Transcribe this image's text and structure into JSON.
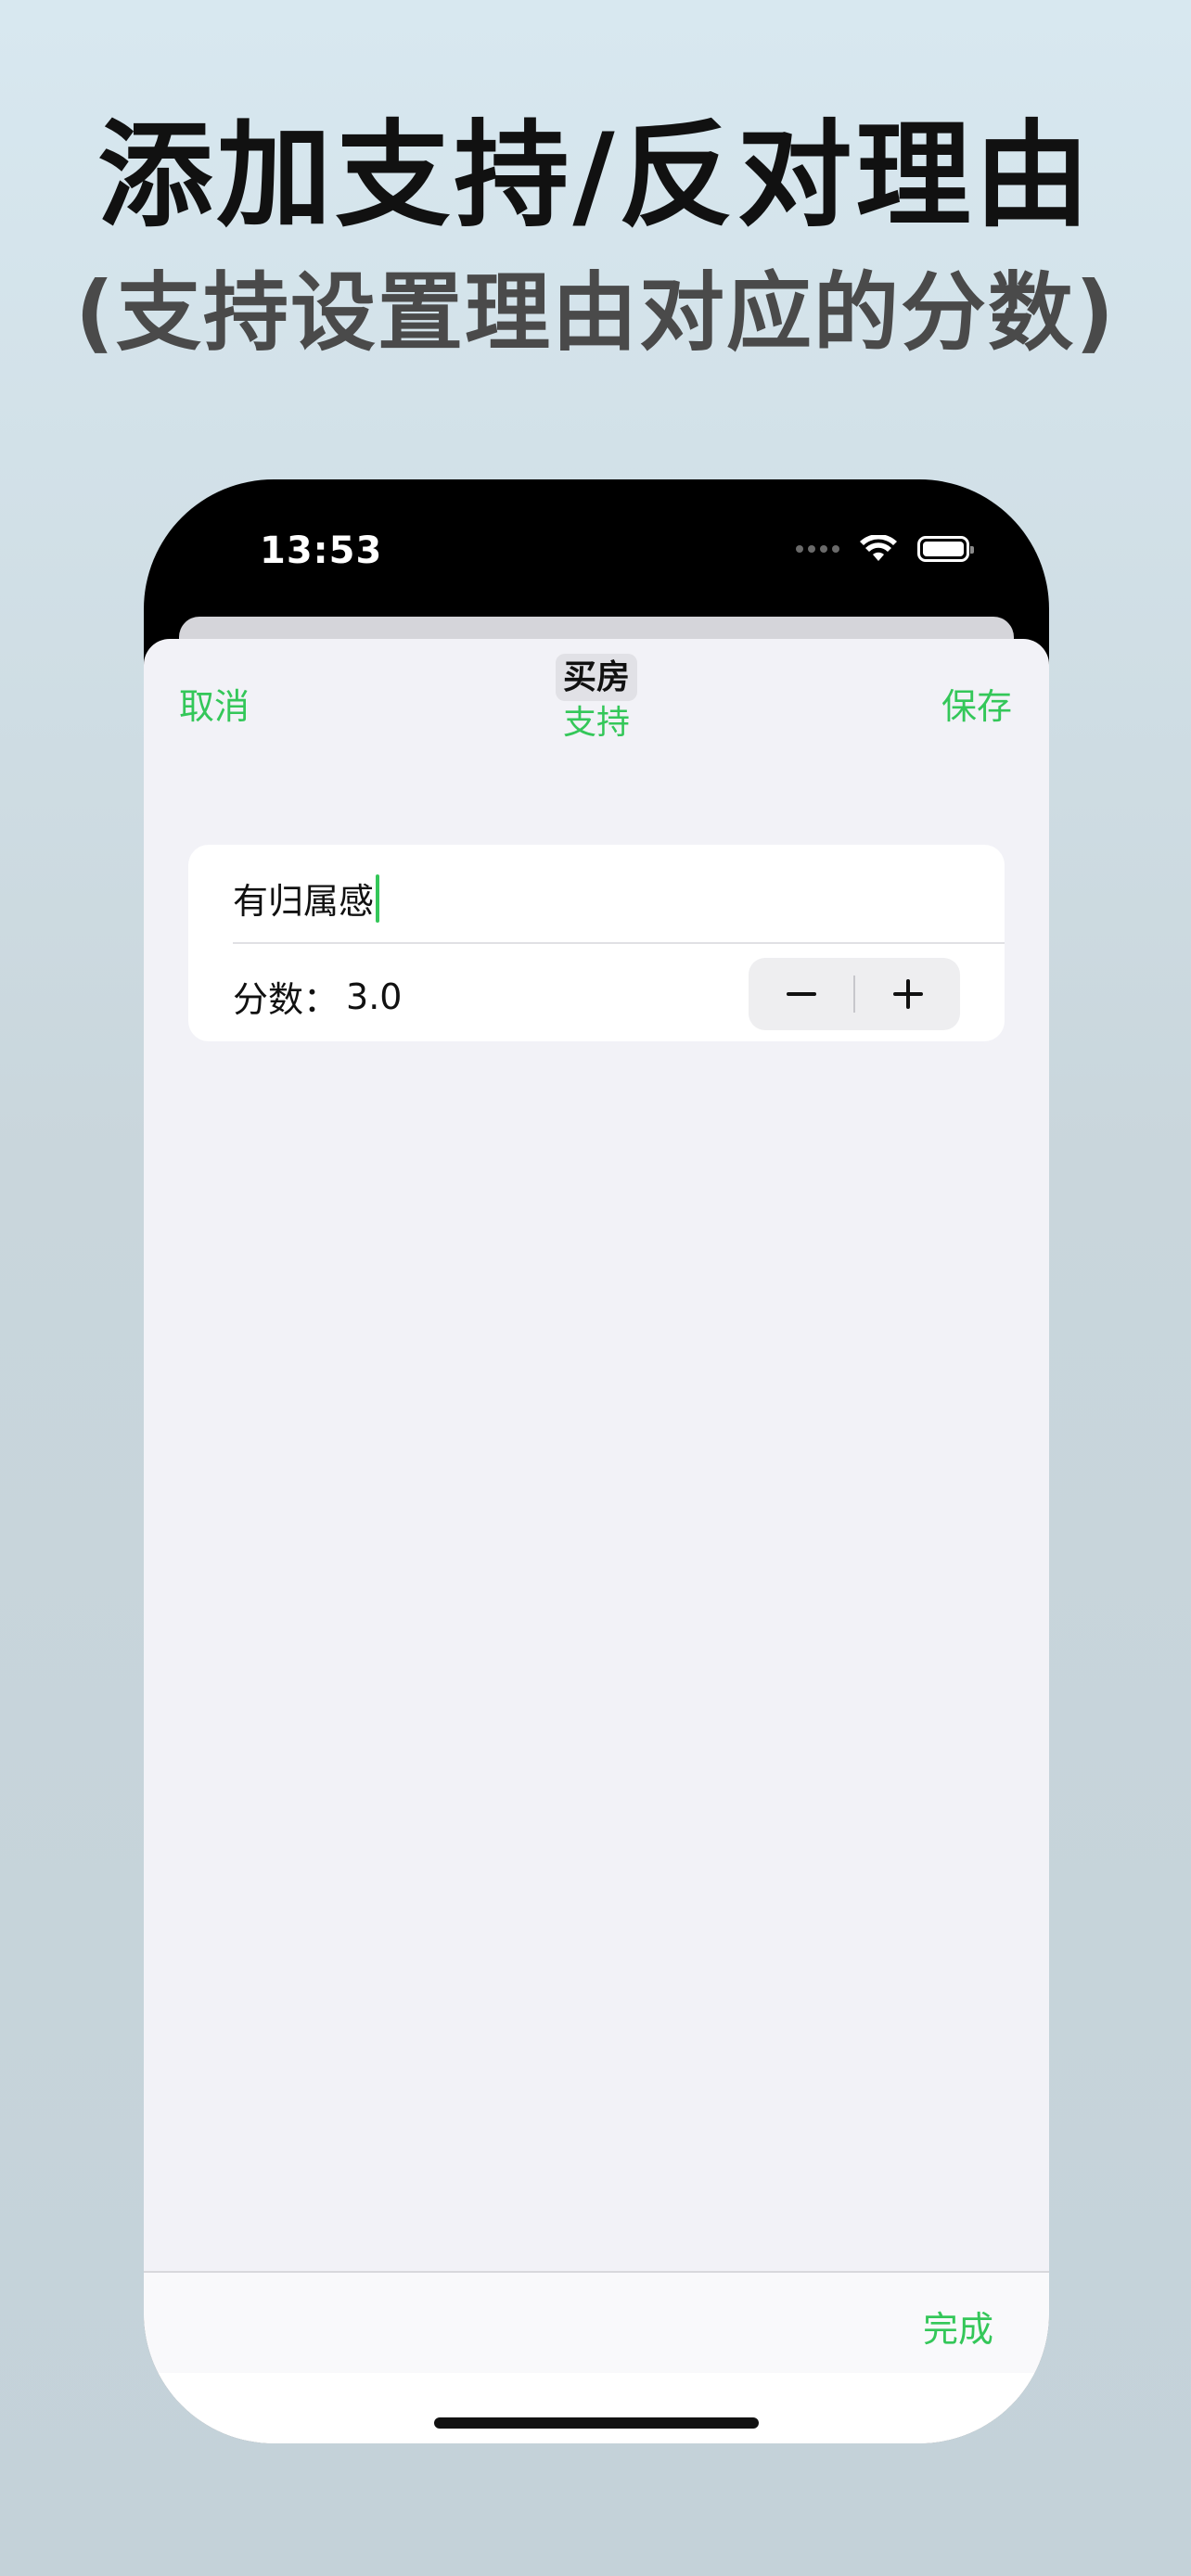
{
  "promo": {
    "headline": "添加支持/反对理由",
    "subline": "(支持设置理由对应的分数)"
  },
  "status_bar": {
    "time": "13:53",
    "icons": [
      "cellular-signal-icon",
      "wifi-icon",
      "battery-icon"
    ]
  },
  "nav": {
    "cancel_label": "取消",
    "title": "买房",
    "subtitle": "支持",
    "save_label": "保存"
  },
  "form": {
    "reason_value": "有归属感",
    "score_label": "分数：",
    "score_value": "3.0",
    "stepper": {
      "decrement_icon": "minus-icon",
      "increment_icon": "plus-icon"
    }
  },
  "keyboard_toolbar": {
    "done_label": "完成"
  },
  "colors": {
    "accent": "#34c759",
    "sheet_background": "#f2f2f7",
    "card_background": "#ffffff"
  }
}
